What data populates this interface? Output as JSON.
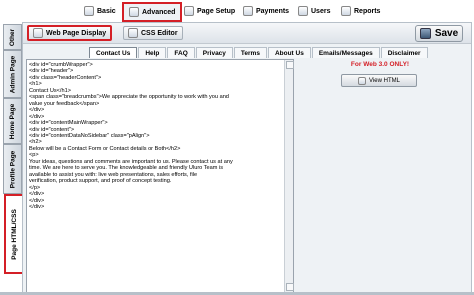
{
  "top_tabs": [
    {
      "label": "Basic",
      "icon": "basic-icon"
    },
    {
      "label": "Advanced",
      "icon": "advanced-icon",
      "active": true
    },
    {
      "label": "Page Setup",
      "icon": "page-setup-icon"
    },
    {
      "label": "Payments",
      "icon": "payments-icon"
    },
    {
      "label": "Users",
      "icon": "users-icon"
    },
    {
      "label": "Reports",
      "icon": "reports-icon"
    }
  ],
  "side_tabs": [
    {
      "label": "Other"
    },
    {
      "label": "Admin Page"
    },
    {
      "label": "Home Page"
    },
    {
      "label": "Profile Page"
    },
    {
      "label": "Page HTML/CSS",
      "active": true
    }
  ],
  "toolbar": {
    "web_page_display": "Web Page Display",
    "css_editor": "CSS Editor",
    "save": "Save"
  },
  "page_tabs": [
    "Contact Us",
    "Help",
    "FAQ",
    "Privacy",
    "Terms",
    "About Us",
    "Emails/Messages",
    "Disclaimer"
  ],
  "editor": {
    "code": "<div id=\"crumbWrapper\">\n<div id=\"header\">\n<div class=\"headerContent\">\n<h1>\nContact Us</h1>\n<span class=\"breadcrumbs\">We appreciate the opportunity to work with you and\nvalue your feedback</span>\n</div>\n</div>\n<div id=\"contentMainWrapper\">\n<div id=\"content\">\n<div id=\"contentDataNoSidebar\" class=\"pAlign\">\n<h2>\nBelow will be a Contact Form or Contact details or Both</h2>\n<p>\nYour ideas, questions and comments are important to us. Please contact us at any\ntime. We are here to serve you. The knowledgeable and friendly Uluro Team is\navailable to assist you with: live web presentations, sales efforts, file\nverification, product support, and proof of concept testing.\n</p>\n</div>\n</div>\n</div>"
  },
  "right_panel": {
    "notice": "For Web 3.0 ONLY!",
    "view_html": "View HTML"
  },
  "colors": {
    "highlight": "#d41f26",
    "notice": "#d41f26",
    "border": "#b7c0c9"
  }
}
